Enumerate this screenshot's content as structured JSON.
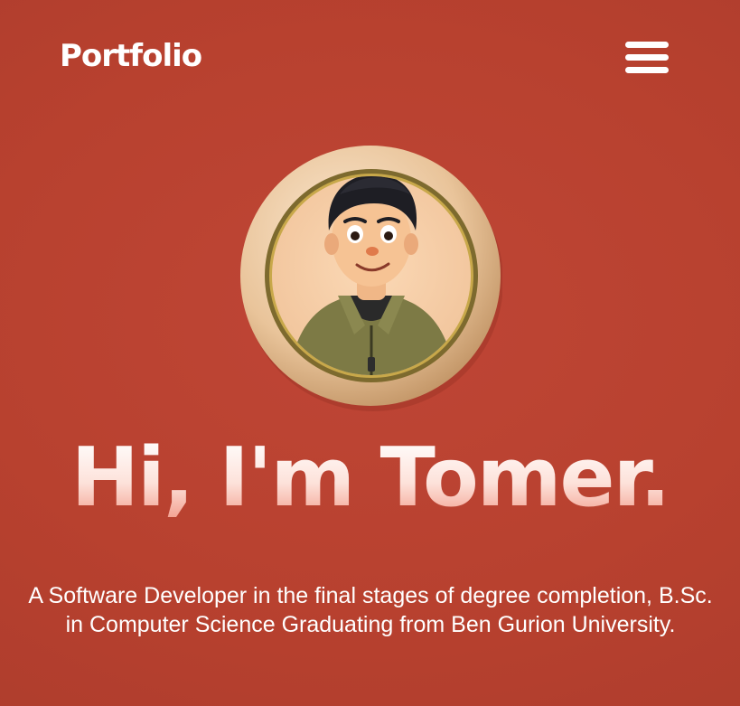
{
  "header": {
    "logo_text": "Portfolio",
    "menu_icon": "hamburger-menu-icon"
  },
  "hero": {
    "avatar_icon": "avatar-portrait",
    "title": "Hi, I'm Tomer.",
    "description": "A Software Developer in the final stages of degree completion, B.Sc. in Computer Science Graduating from Ben Gurion University."
  },
  "colors": {
    "background": "#b8412f",
    "text": "#ffffff",
    "title_gradient_end": "#f29b8a"
  }
}
